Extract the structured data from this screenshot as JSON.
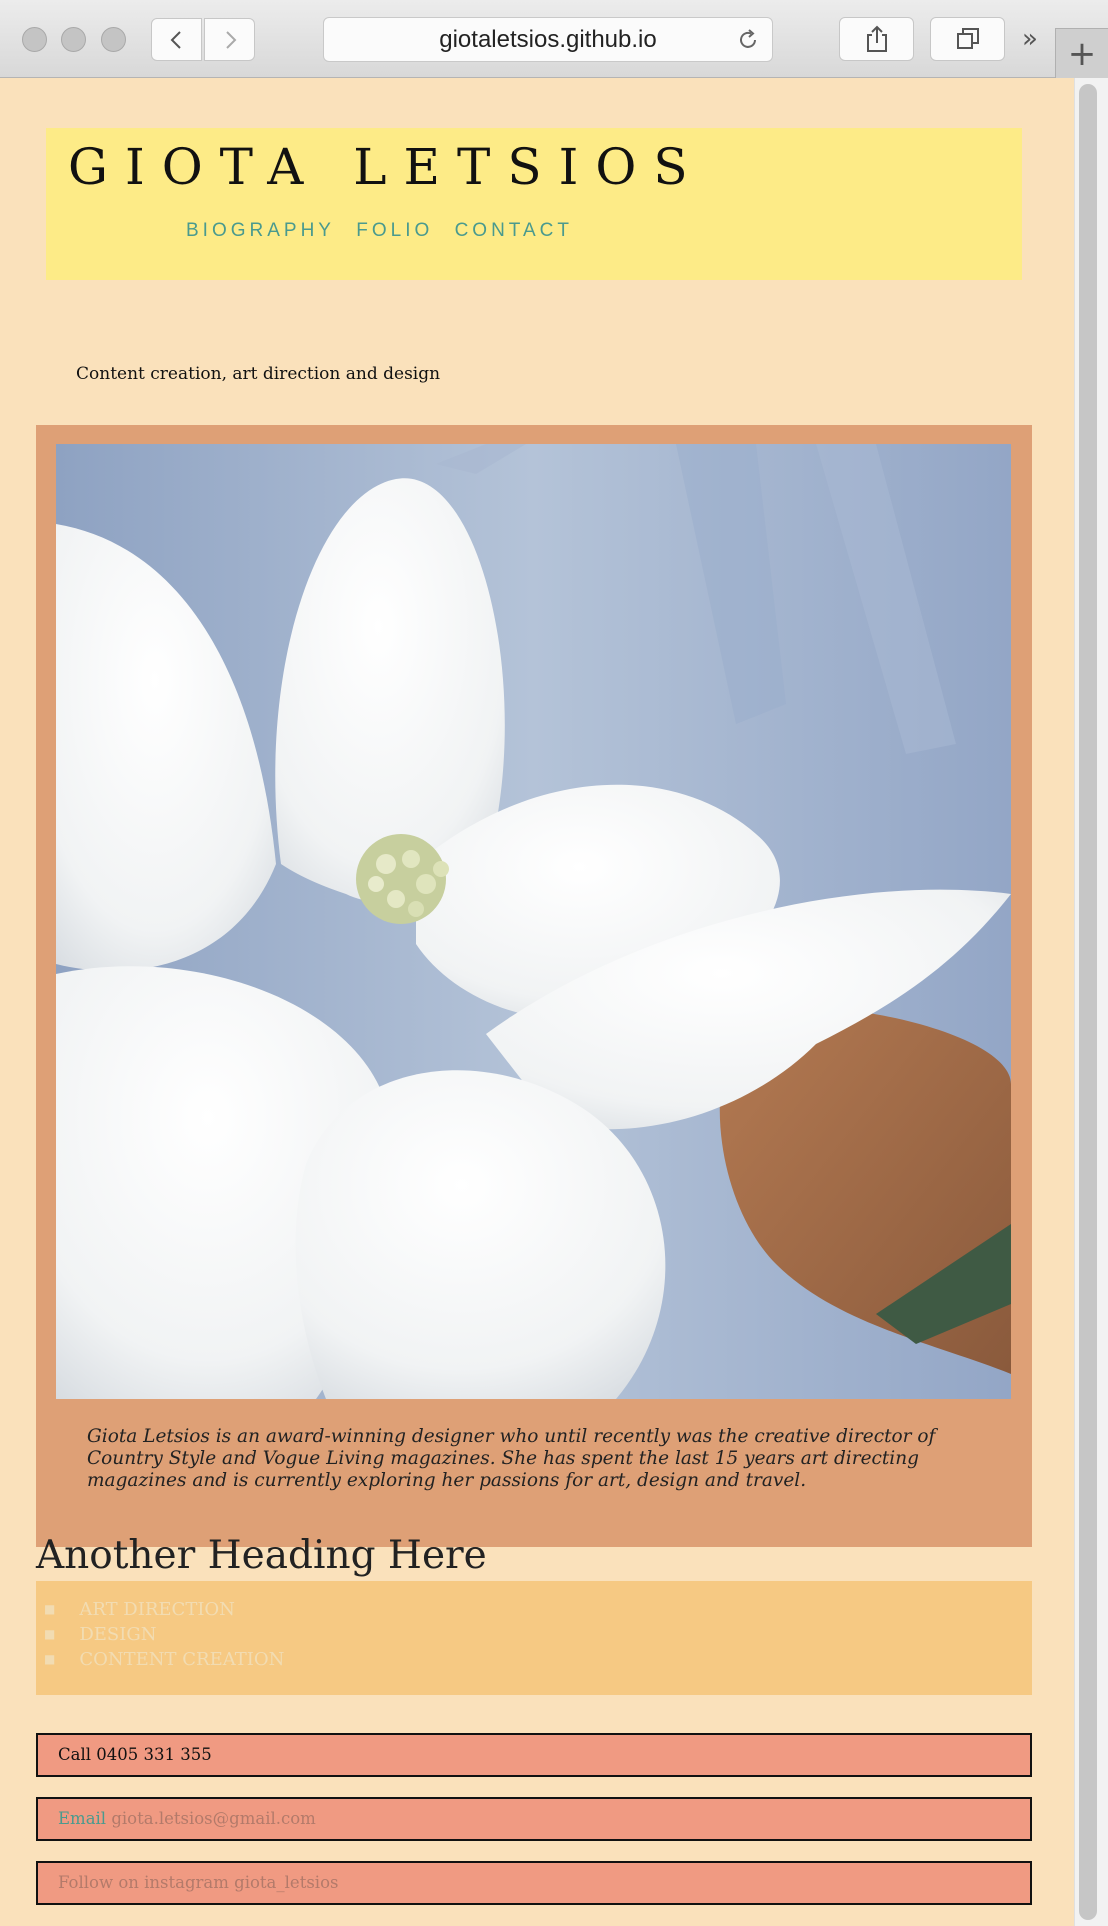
{
  "browser": {
    "url": "giotaletsios.github.io",
    "more_glyph": "»",
    "newtab_glyph": "+"
  },
  "header": {
    "title": "GIOTA LETSIOS",
    "nav": [
      "BIOGRAPHY",
      "FOLIO",
      "CONTACT"
    ]
  },
  "tagline": "Content creation, art direction and design",
  "feature": {
    "bio": "Giota Letsios is an award-winning designer who until recently was the creative director of Country Style and Vogue Living magazines. She has spent the last 15 years art directing magazines and is currently exploring her passions for art, design and travel."
  },
  "section": {
    "heading": "Another Heading Here",
    "items": [
      "ART DIRECTION",
      "DESIGN",
      "CONTENT CREATION"
    ]
  },
  "contact": {
    "call": "Call 0405 331 355",
    "email_label": "Email",
    "email": "giota.letsios@gmail.com",
    "instagram": "Follow on instagram giota_letsios"
  },
  "colors": {
    "page_bg": "#fae1bb",
    "banner": "#fdeb87",
    "nav": "#4a9a8e",
    "feature_bg": "#dea076",
    "services_bg": "#f6c983",
    "contact_bg": "#f09a82"
  }
}
